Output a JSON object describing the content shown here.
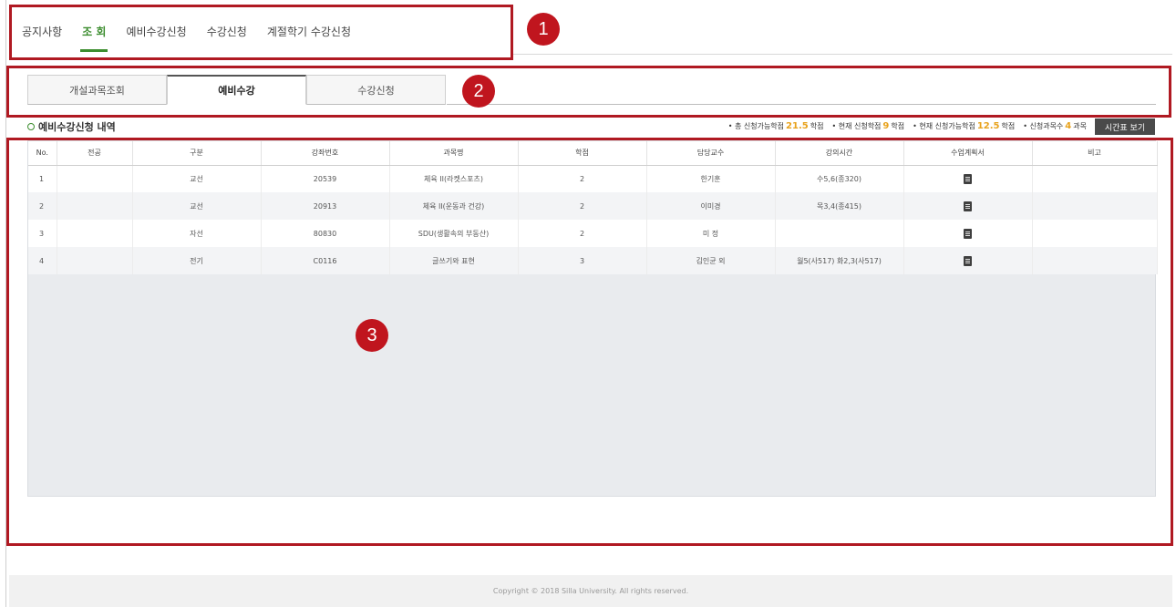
{
  "topnav": {
    "items": [
      {
        "label": "공지사항",
        "active": false
      },
      {
        "label": "조 회",
        "active": true
      },
      {
        "label": "예비수강신청",
        "active": false
      },
      {
        "label": "수강신청",
        "active": false
      },
      {
        "label": "계절학기 수강신청",
        "active": false
      }
    ]
  },
  "tabs": [
    {
      "label": "개설과목조회",
      "active": false
    },
    {
      "label": "예비수강",
      "active": true
    },
    {
      "label": "수강신청",
      "active": false
    }
  ],
  "section": {
    "title": "예비수강신청 내역",
    "credits": [
      {
        "prefix": "• 총 신청가능학점",
        "value": "21.5",
        "unit": "학점"
      },
      {
        "prefix": "• 현재 신청학점",
        "value": "9",
        "unit": "학점"
      },
      {
        "prefix": "• 현재 신청가능학점",
        "value": "12.5",
        "unit": "학점"
      },
      {
        "prefix": "• 신청과목수",
        "value": "4",
        "unit": "과목"
      }
    ],
    "timetable_button": "시간표 보기"
  },
  "table": {
    "columns": [
      "No.",
      "전공",
      "구분",
      "강좌번호",
      "과목명",
      "학점",
      "담당교수",
      "강의시간",
      "수업계획서",
      "비고"
    ],
    "rows": [
      [
        "1",
        "",
        "교선",
        "20539",
        "체육 II(라켓스포츠)",
        "2",
        "한기훈",
        "수5,6(종320)",
        "doc-icon",
        ""
      ],
      [
        "2",
        "",
        "교선",
        "20913",
        "체육 II(운동과 건강)",
        "2",
        "이미경",
        "목3,4(종415)",
        "doc-icon",
        ""
      ],
      [
        "3",
        "",
        "자선",
        "80830",
        "SDU(생활속의 부동산)",
        "2",
        "미 정",
        "",
        "doc-icon",
        ""
      ],
      [
        "4",
        "",
        "전기",
        "C0116",
        "글쓰기와 표현",
        "3",
        "김인균 외",
        "월5(사517) 화2,3(사517)",
        "doc-icon",
        ""
      ]
    ]
  },
  "annotations": [
    "1",
    "2",
    "3"
  ],
  "footer": {
    "copyright": "Copyright © 2018 Silla University. All rights reserved."
  },
  "colors": {
    "accent_green": "#3c8d2f",
    "annotation_red": "#b01922",
    "credit_highlight": "#e8a21c",
    "button_dark": "#4a4a4a"
  }
}
